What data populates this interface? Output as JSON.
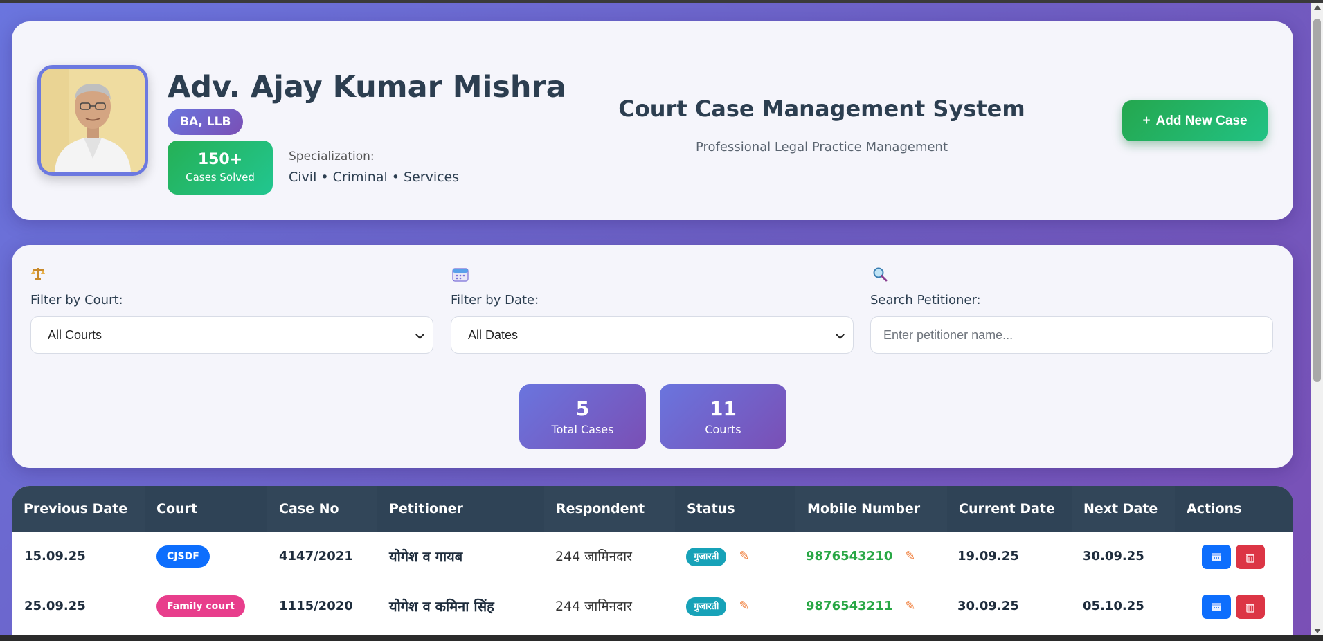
{
  "header": {
    "name": "Adv. Ajay Kumar Mishra",
    "degree": "BA, LLB",
    "cases_solved_count": "150+",
    "cases_solved_label": "Cases Solved",
    "specialization_label": "Specialization:",
    "specialization_value": "Civil • Criminal • Services",
    "system_title": "Court Case Management System",
    "system_subtitle": "Professional Legal Practice Management",
    "add_case_label": "Add New Case"
  },
  "filters": {
    "court": {
      "icon": "scales-icon",
      "label": "Filter by Court:",
      "selected": "All Courts"
    },
    "date": {
      "icon": "calendar-icon",
      "label": "Filter by Date:",
      "selected": "All Dates"
    },
    "search": {
      "icon": "magnifier-icon",
      "label": "Search Petitioner:",
      "placeholder": "Enter petitioner name..."
    }
  },
  "stats": [
    {
      "value": "5",
      "label": "Total Cases"
    },
    {
      "value": "11",
      "label": "Courts"
    }
  ],
  "table": {
    "headers": [
      "Previous Date",
      "Court",
      "Case No",
      "Petitioner",
      "Respondent",
      "Status",
      "Mobile Number",
      "Current Date",
      "Next Date",
      "Actions"
    ],
    "rows": [
      {
        "previous_date": "15.09.25",
        "court": "CJSDF",
        "court_color": "#0d6efd",
        "case_no": "4147/2021",
        "petitioner": "योगेश व गायब",
        "respondent": "244 जामिनदार",
        "status": "गुजारती",
        "mobile": "9876543210",
        "current_date": "19.09.25",
        "next_date": "30.09.25"
      },
      {
        "previous_date": "25.09.25",
        "court": "Family court",
        "court_color": "#e83e8c",
        "case_no": "1115/2020",
        "petitioner": "योगेश व कमिना सिंह",
        "respondent": "244 जामिनदार",
        "status": "गुजारती",
        "mobile": "9876543211",
        "current_date": "30.09.25",
        "next_date": "05.10.25"
      }
    ]
  },
  "colors": {
    "accent_gradient_start": "#6a75de",
    "accent_gradient_end": "#7a4fb5",
    "success": "#28a745",
    "table_header": "#324659",
    "status": "#17a2b8",
    "action_blue": "#0d6efd",
    "action_red": "#dc3545"
  }
}
